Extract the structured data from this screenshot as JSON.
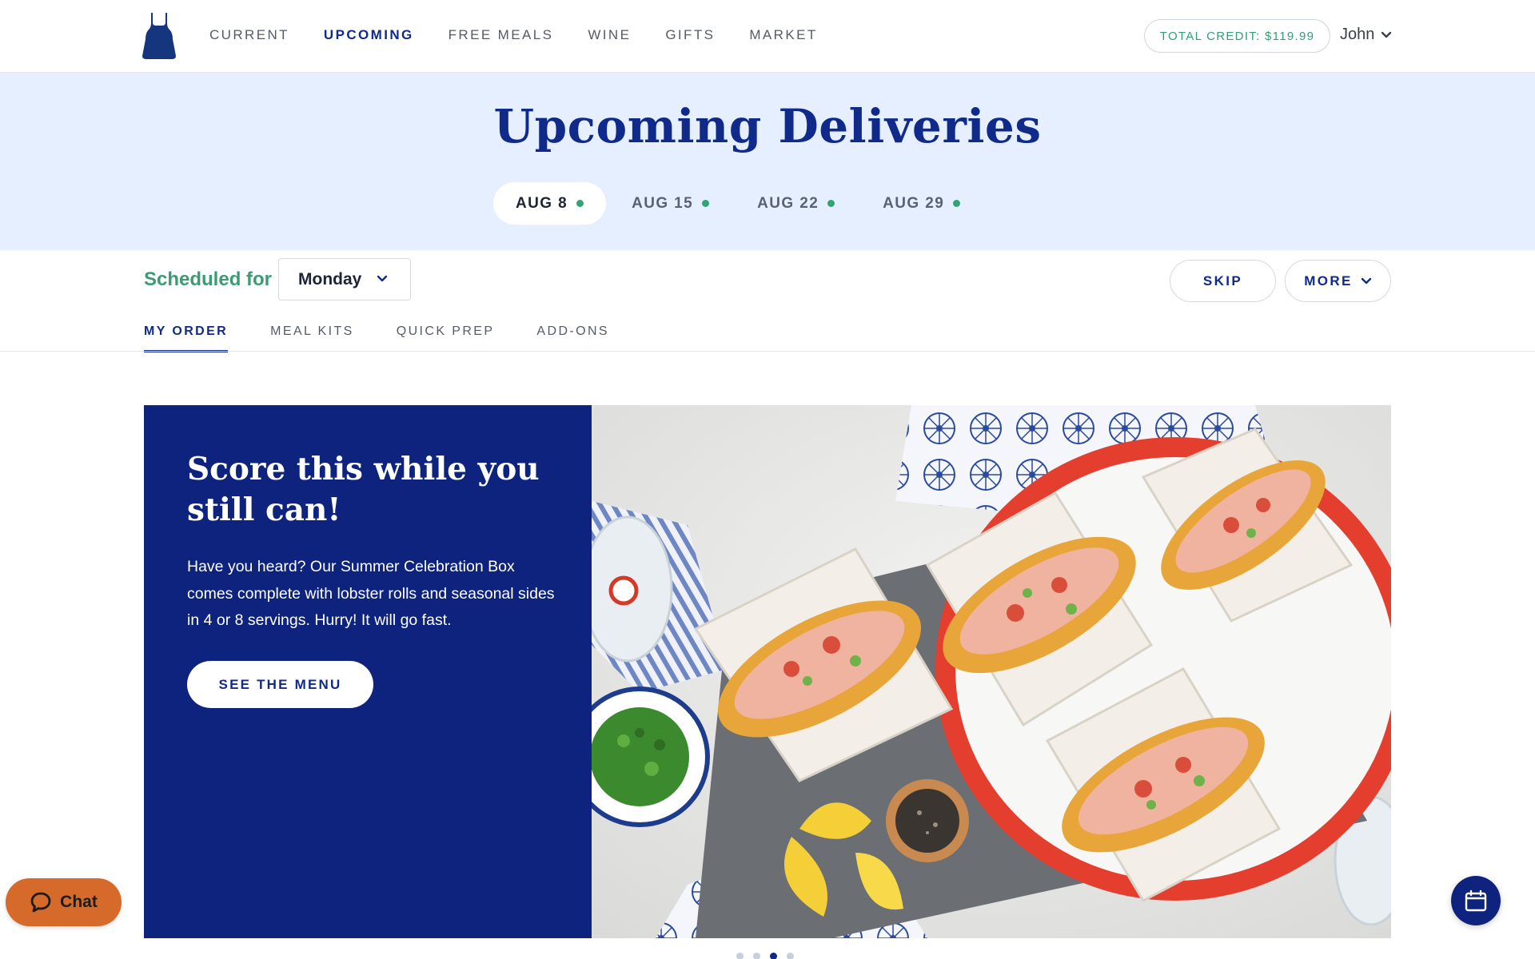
{
  "nav": {
    "logo_icon": "apron-logo-icon",
    "links": [
      {
        "label": "CURRENT",
        "active": false
      },
      {
        "label": "UPCOMING",
        "active": true
      },
      {
        "label": "FREE MEALS",
        "active": false
      },
      {
        "label": "WINE",
        "active": false
      },
      {
        "label": "GIFTS",
        "active": false
      },
      {
        "label": "MARKET",
        "active": false
      }
    ],
    "credit": "TOTAL CREDIT: $119.99",
    "user_name": "John"
  },
  "header": {
    "title": "Upcoming Deliveries",
    "dates": [
      {
        "label": "AUG 8",
        "active": true
      },
      {
        "label": "AUG 15",
        "active": false
      },
      {
        "label": "AUG 22",
        "active": false
      },
      {
        "label": "AUG 29",
        "active": false
      }
    ]
  },
  "schedule": {
    "label": "Scheduled for",
    "day": "Monday",
    "skip_label": "SKIP",
    "more_label": "MORE"
  },
  "subtabs": [
    {
      "label": "MY ORDER",
      "active": true
    },
    {
      "label": "MEAL KITS",
      "active": false
    },
    {
      "label": "QUICK PREP",
      "active": false
    },
    {
      "label": "ADD-ONS",
      "active": false
    }
  ],
  "promo": {
    "title": "Score this while you still can!",
    "body": "Have you heard? Our Summer Celebration Box comes complete with lobster rolls and seasonal sides in 4 or 8 servings. Hurry! It will go fast.",
    "cta": "SEE THE MENU",
    "image_icon": "lobster-rolls-photo"
  },
  "carousel": {
    "count": 4,
    "active_index": 2
  },
  "chat": {
    "label": "Chat"
  },
  "colors": {
    "brand_navy": "#0f2a8a",
    "promo_navy": "#0d237e",
    "band_blue": "#e6efff",
    "accent_green": "#33a373",
    "chat_orange": "#d56a2b"
  }
}
